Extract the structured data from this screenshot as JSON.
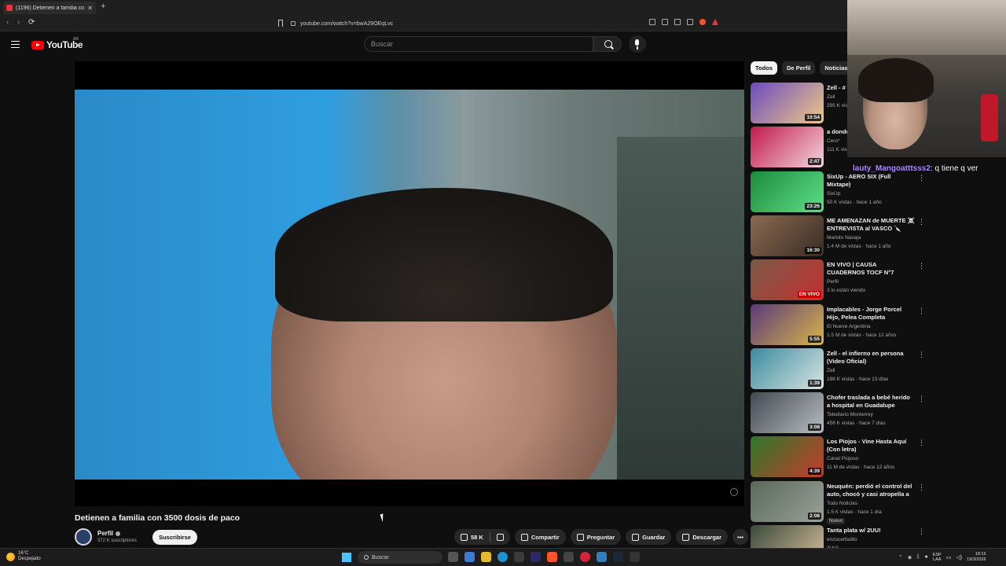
{
  "browser": {
    "tab_title": "(1196) Detienen a familia con",
    "tab_close": "✕",
    "new_tab": "+",
    "url": "youtube.com/watch?v=bwA29OEqLvc",
    "back_icon": "‹",
    "forward_icon": "›",
    "reload_icon": "⟳"
  },
  "header": {
    "logo_text": "YouTube",
    "region": "AR",
    "search_placeholder": "Buscar"
  },
  "video": {
    "title": "Detienen a familia con 3500 dosis de paco",
    "channel": "Perfil",
    "subscribers": "372 K suscriptores",
    "subscribe_label": "Suscribirse",
    "likes": "58 K",
    "share_label": "Compartir",
    "ask_label": "Preguntar",
    "save_label": "Guardar",
    "download_label": "Descargar",
    "more_label": "•••"
  },
  "chips": [
    "Todos",
    "De Perfil",
    "Noticias"
  ],
  "recommendations": [
    {
      "title": "Zell - #",
      "channel": "Zell",
      "meta": "295 K vis",
      "duration": "10:54",
      "colors": [
        "#6b4bbf",
        "#f0c987"
      ]
    },
    {
      "title": "a donde",
      "channel": "Cero*",
      "meta": "111 K vis",
      "duration": "2:47",
      "colors": [
        "#c2184b",
        "#f4d6e0"
      ]
    },
    {
      "title": "SixUp - AERO SIX (Full Mixtape)",
      "channel": "SixUp",
      "meta": "50 K vistas · hace 1 año",
      "duration": "23:26",
      "colors": [
        "#1d8a3a",
        "#5de08a"
      ]
    },
    {
      "title": "ME AMENAZAN de MUERTE ☠️ ENTREVISTA al VASCO 🔪",
      "channel": "Markito Navaja",
      "meta": "1.4 M de vistas · hace 1 año",
      "duration": "16:30",
      "colors": [
        "#8a6a50",
        "#3a2c24"
      ]
    },
    {
      "title": "EN VIVO | CAUSA CUADERNOS TOCF N°7",
      "channel": "Perfil",
      "meta": "3 lo están viendo",
      "duration": "EN VIVO",
      "live": true,
      "colors": [
        "#7a5a48",
        "#c43030"
      ]
    },
    {
      "title": "Implacables - Jorge Porcel Hijo, Pelea Completa",
      "channel": "El Nueve Argentina",
      "meta": "1.5 M de vistas · hace 12 años",
      "duration": "5:55",
      "colors": [
        "#5a3a7a",
        "#d9b54a"
      ]
    },
    {
      "title": "Zell - el infierno en persona (Video Oficial)",
      "channel": "Zell",
      "meta": "188 K vistas · hace 13 días",
      "duration": "1:39",
      "colors": [
        "#3b8ba0",
        "#d8e4e0"
      ]
    },
    {
      "title": "Chofer traslada a bebé herido a hospital en Guadalupe",
      "channel": "Telediario Monterrey",
      "meta": "456 K vistas · hace 7 días",
      "duration": "3:08",
      "colors": [
        "#444a52",
        "#b8bcc2"
      ]
    },
    {
      "title": "Los Piojos - Vine Hasta Aquí (Con letra)",
      "channel": "Canal Piojoso",
      "meta": "11 M de vistas · hace 12 años",
      "duration": "4:39",
      "colors": [
        "#2a7a2a",
        "#c83a2a"
      ]
    },
    {
      "title": "Neuquén: perdió el control del auto, chocó y casi atropella a ...",
      "channel": "Todo Noticias",
      "meta": "1.5 K vistas · hace 1 día",
      "duration": "2:08",
      "badge": "Nuevo",
      "colors": [
        "#5a6a5a",
        "#9aa09a"
      ]
    },
    {
      "title": "Tanta plata w/ 2UU!",
      "channel": "enzocerbulito",
      "meta": "2UU!",
      "duration": "",
      "colors": [
        "#3a4a3a",
        "#d8c0a0"
      ]
    }
  ],
  "chat": {
    "user": "lauty_Mangoatttsss2",
    "message": ": q tiene q ver"
  },
  "taskbar": {
    "temp": "16°C",
    "condition": "Despejado",
    "search_label": "Buscar",
    "lang": "ESP",
    "lang2": "LAA",
    "time": "18:15",
    "date": "19/3/2026"
  }
}
